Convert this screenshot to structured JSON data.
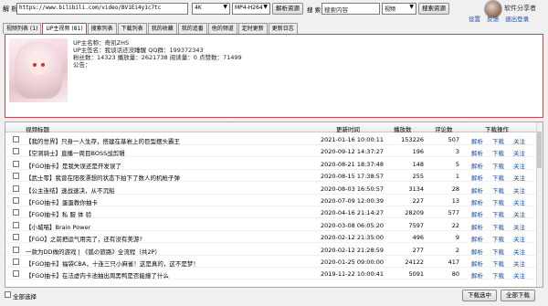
{
  "toolbar": {
    "parse_label": "解 析",
    "url_value": "https://www.bilibili.com/video/BV1Ei4y1c7tc",
    "quality_value": "4K",
    "format_value": "MP4-H264",
    "parse_button": "解析资源",
    "search_label": "搜 索",
    "search_placeholder": "搜索内容",
    "search_type_value": "视频",
    "search_button": "搜索资源"
  },
  "profile": {
    "app_title": "软件分享者",
    "links": [
      "设置",
      "反馈",
      "退出登录"
    ]
  },
  "tabs": [
    "视频列表 (1)",
    "UP主视频 (81)",
    "搜索列表",
    "下载列表",
    "我的收藏",
    "我的追番",
    "他的频道",
    "定时更新",
    "更新日志"
  ],
  "active_tab": 1,
  "up_info": {
    "line1": "UP主名称：奇凯ZHS",
    "line2": "UP主签名：我谈话还没睡醒 QQ群：199372343",
    "line3": "粉丝数：14323  播放量：2621738  阅读量：0  点赞数：71499",
    "line4": "公告："
  },
  "table": {
    "headers": [
      "视频标题",
      "更新时间",
      "播放数",
      "评论数",
      "下载操作"
    ],
    "actions": [
      "解析",
      "下载",
      "关注"
    ],
    "rows": [
      {
        "title": "【我的世界】只身一人生存，搭建在基岩上的巨型摆头霸王",
        "time": "2021-01-16 10:00:11",
        "plays": "153226",
        "comments": "507"
      },
      {
        "title": "【空洞骑士】直播一周目BOSS战剪辑",
        "time": "2020-09-12 14:37:27",
        "plays": "196",
        "comments": "3"
      },
      {
        "title": "【FGO抽卡】是我失误还是开发误了",
        "time": "2020-08-21 18:37:48",
        "plays": "148",
        "comments": "5"
      },
      {
        "title": "【武士零】我曾在阳夜漂想的状态下拍下了数人的机枪子弹",
        "time": "2020-08-15 17:38:57",
        "plays": "255",
        "comments": "1"
      },
      {
        "title": "【公主连结】速战速决，从不沉船",
        "time": "2020-08-03 16:50:57",
        "plays": "3134",
        "comments": "28"
      },
      {
        "title": "【FGO抽卡】蛋蛋教你抽卡",
        "time": "2020-07-09 12:00:39",
        "plays": "227",
        "comments": "13"
      },
      {
        "title": "【FGO抽卡】私 服 体 验",
        "time": "2020-04-16 21:14:27",
        "plays": "28209",
        "comments": "577"
      },
      {
        "title": "【小城喵】Brain Power",
        "time": "2020-03-08 06:05:20",
        "plays": "7597",
        "comments": "22"
      },
      {
        "title": "【FGO】之前把运气用完了，还有没有美游?",
        "time": "2020-02-12 21:35:00",
        "plays": "496",
        "comments": "9"
      },
      {
        "title": "一款为DD做的游戏 | 《狐の旅路》全流程（共2P）",
        "time": "2020-02-12 21:28:59",
        "plays": "277",
        "comments": "2"
      },
      {
        "title": "【FGO抽卡】福袋CBA，十连三只小麻雀！这是真的，这不是梦！",
        "time": "2020-01-25 09:00:00",
        "plays": "24122",
        "comments": "417"
      },
      {
        "title": "【FGO抽卡】在法虚内卡池抽出周黑鸭是否能撞了什么",
        "time": "2019-11-22 10:00:41",
        "plays": "5091",
        "comments": "80"
      }
    ]
  },
  "bottom": {
    "select_all": "全部选择",
    "download_selected": "下载选中",
    "download_all": "全部下载"
  }
}
